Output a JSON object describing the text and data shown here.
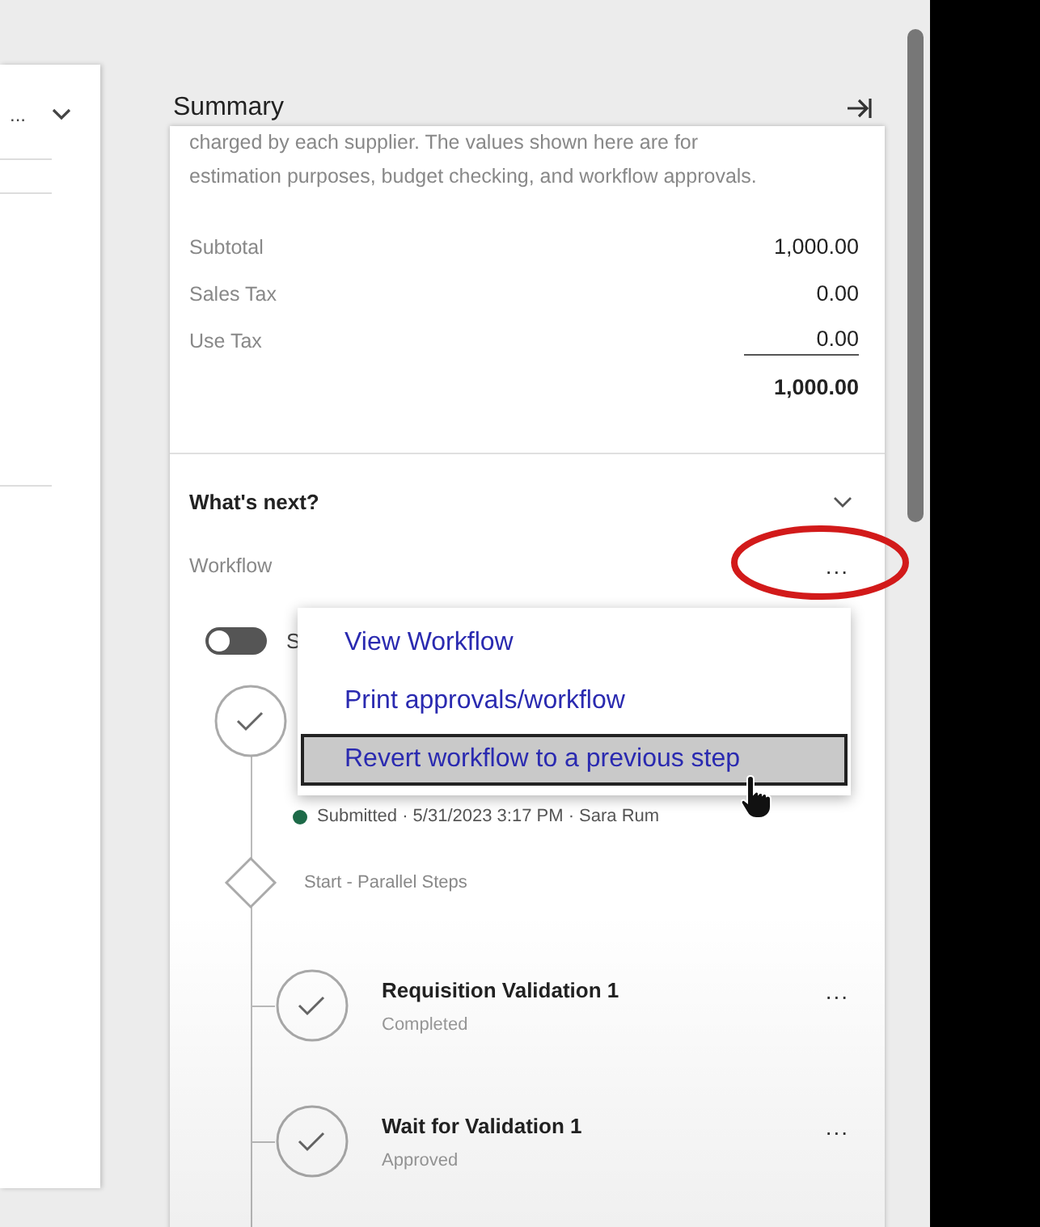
{
  "left_panel": {
    "field_text": "..."
  },
  "summary": {
    "title": "Summary",
    "description": "charged by each supplier. The values shown here are for estimation purposes, budget checking, and workflow approvals.",
    "rows": [
      {
        "label": "Subtotal",
        "value": "1,000.00"
      },
      {
        "label": "Sales Tax",
        "value": "0.00"
      },
      {
        "label": "Use Tax",
        "value": "0.00"
      }
    ],
    "total": "1,000.00"
  },
  "whats_next": {
    "title": "What's next?",
    "expanded": true,
    "workflow_label": "Workflow",
    "more": "...",
    "toggle": {
      "on": false,
      "label": "S"
    },
    "menu": [
      {
        "label": "View Workflow",
        "selected": false
      },
      {
        "label": "Print approvals/workflow",
        "selected": false
      },
      {
        "label": "Revert workflow to a previous step",
        "selected": true
      }
    ],
    "steps": [
      {
        "kind": "approval",
        "status": "Submitted · 5/31/2023 3:17 PM · Sara Rum",
        "color": "#1d6a48"
      },
      {
        "kind": "gateway",
        "title": "Start - Parallel Steps"
      },
      {
        "kind": "task",
        "title": "Requisition Validation 1",
        "status": "Completed",
        "more": "..."
      },
      {
        "kind": "task",
        "title": "Wait for Validation 1",
        "status": "Approved",
        "more": "..."
      }
    ]
  }
}
